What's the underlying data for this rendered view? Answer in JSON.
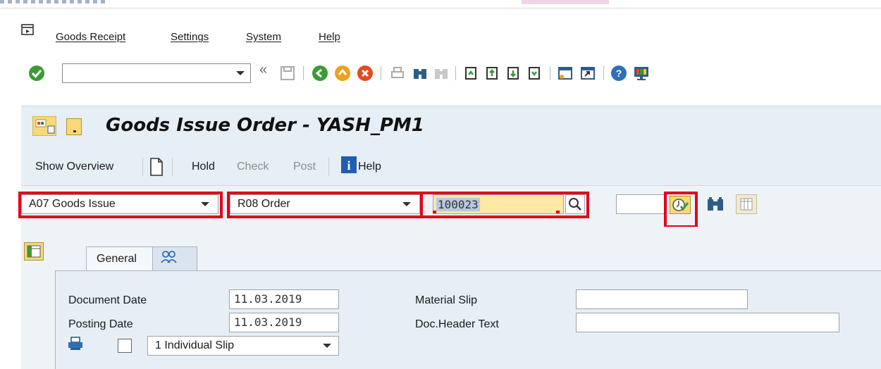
{
  "menu": {
    "items": [
      "Goods Receipt",
      "Settings",
      "System",
      "Help"
    ]
  },
  "system_toolbar": {
    "command_field_value": "",
    "icons": [
      "enter-icon",
      "back-icon",
      "save-icon",
      "back-nav-icon",
      "exit-icon",
      "cancel-icon",
      "print-icon",
      "find-icon",
      "find-next-icon",
      "first-page-icon",
      "prev-page-icon",
      "next-page-icon",
      "last-page-icon",
      "create-session-icon",
      "shortcut-icon",
      "help-icon",
      "customize-icon"
    ]
  },
  "title": {
    "text": "Goods Issue Order - YASH_PM1"
  },
  "app_toolbar": {
    "show_overview": "Show Overview",
    "hold": "Hold",
    "check": "Check",
    "post": "Post",
    "help": "Help"
  },
  "selection": {
    "action": "A07 Goods Issue",
    "reference": "R08 Order",
    "order_number": "100023",
    "extra_field": ""
  },
  "tabs": {
    "general": "General"
  },
  "fields": {
    "document_date_label": "Document Date",
    "document_date": "11.03.2019",
    "posting_date_label": "Posting Date",
    "posting_date": "11.03.2019",
    "material_slip_label": "Material Slip",
    "material_slip": "",
    "doc_header_text_label": "Doc.Header Text",
    "doc_header_text": "",
    "print_version": "1 Individual Slip",
    "print_checked": false
  },
  "colors": {
    "highlight_red": "#e3001b",
    "input_focus_yellow": "#fbe9a4",
    "panel_blue": "#e6eef6",
    "enter_green": "#3c9a37"
  }
}
